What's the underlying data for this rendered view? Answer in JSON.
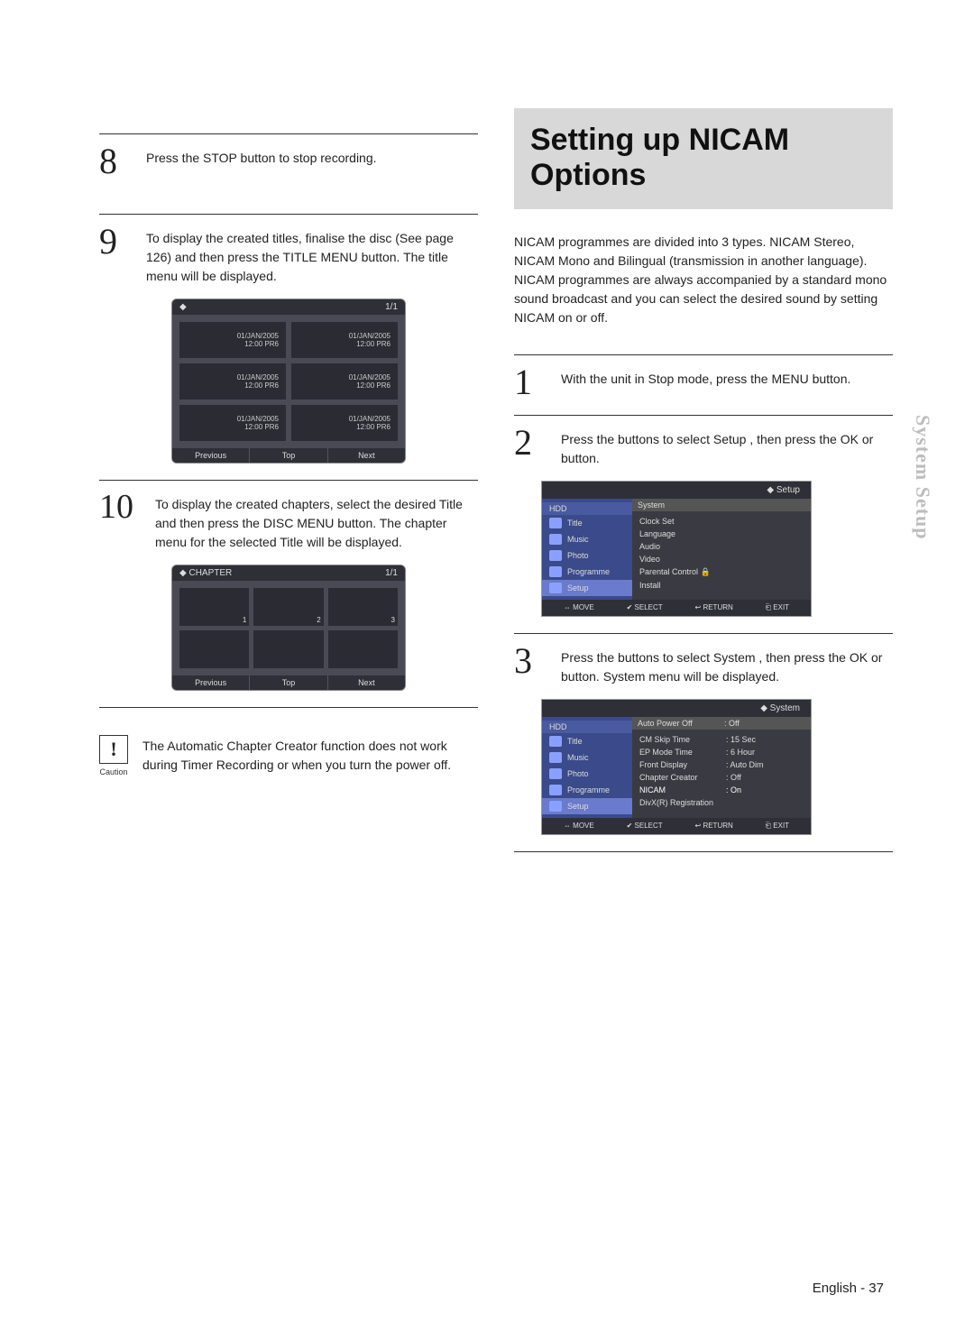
{
  "sidebar_label": "System Setup",
  "footer": "English - 37",
  "left": {
    "step8": {
      "num": "8",
      "text": "Press the STOP button to stop recording."
    },
    "step9": {
      "num": "9",
      "text": "To display the created titles, finalise the disc (See page 126) and then press the TITLE MENU button. The title menu will be displayed."
    },
    "osd_titles": {
      "header_left": "◆",
      "header_right": "1/1",
      "cell_line1": "01/JAN/2005",
      "cell_line2": "12:00  PR6",
      "btn_prev": "Previous",
      "btn_top": "Top",
      "btn_next": "Next"
    },
    "step10": {
      "num": "10",
      "text": "To display the created chapters, select the desired Title and then press the DISC MENU button. The chapter menu for the selected Title will be displayed."
    },
    "osd_chapters": {
      "header_left": "◆ CHAPTER",
      "header_right": "1/1",
      "thumbs": [
        "1",
        "2",
        "3",
        "",
        "",
        ""
      ],
      "btn_prev": "Previous",
      "btn_top": "Top",
      "btn_next": "Next"
    },
    "caution": {
      "icon": "!",
      "label": "Caution",
      "text": "The Automatic Chapter Creator function does not work during Timer Recording or when you turn the power off."
    }
  },
  "right": {
    "title": "Setting up NICAM Options",
    "intro": "NICAM programmes are divided into 3 types. NICAM Stereo, NICAM Mono and Bilingual (transmission in another language). NICAM programmes are always accompanied by a standard mono sound broadcast and you can select the desired sound by setting NICAM  on or off.",
    "step1": {
      "num": "1",
      "text": "With the unit in Stop mode, press the MENU button."
    },
    "step2": {
      "num": "2",
      "text": "Press the          buttons to select Setup , then press the OK or      button."
    },
    "osd_setup": {
      "top_right": "◆   Setup",
      "left_hdr": "HDD",
      "left_items": [
        "Title",
        "Music",
        "Photo",
        "Programme",
        "Setup"
      ],
      "right_hdr": "System",
      "right_items": [
        "Clock Set",
        "Language",
        "Audio",
        "Video",
        "Parental Control   🔒",
        "Install"
      ],
      "hints": [
        "⇔ MOVE",
        "✔ SELECT",
        "↩ RETURN",
        "⎗ EXIT"
      ]
    },
    "step3": {
      "num": "3",
      "text": "Press the          buttons to select System , then press the OK or     button. System menu will be displayed."
    },
    "osd_system": {
      "top_right": "◆   System",
      "left_hdr": "HDD",
      "left_items": [
        "Title",
        "Music",
        "Photo",
        "Programme",
        "Setup"
      ],
      "right_rows": [
        {
          "k": "Auto Power Off",
          "v": ": Off"
        },
        {
          "k": "CM Skip Time",
          "v": ": 15 Sec"
        },
        {
          "k": "EP Mode Time",
          "v": ": 6 Hour"
        },
        {
          "k": "Front Display",
          "v": ": Auto Dim"
        },
        {
          "k": "Chapter Creator",
          "v": ": Off"
        },
        {
          "k": "NICAM",
          "v": ": On"
        },
        {
          "k": "DivX(R) Registration",
          "v": ""
        }
      ],
      "hints": [
        "⇔ MOVE",
        "✔ SELECT",
        "↩ RETURN",
        "⎗ EXIT"
      ]
    }
  }
}
